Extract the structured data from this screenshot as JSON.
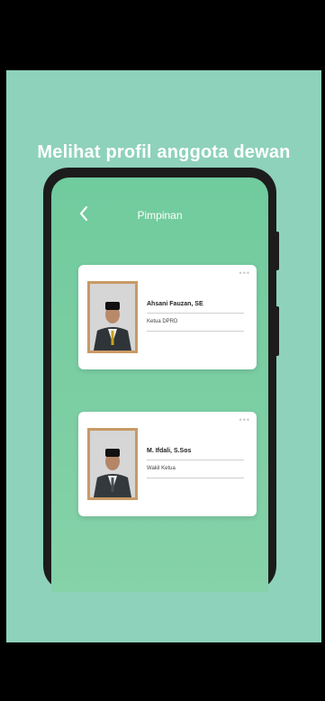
{
  "headline": "Melihat profil anggota dewan",
  "app": {
    "title": "Pimpinan",
    "members": [
      {
        "name": "Ahsani Fauzan, SE",
        "role": "Ketua DPRD"
      },
      {
        "name": "M. Ifdali, S.Sos",
        "role": "Wakil Ketua"
      }
    ]
  },
  "colors": {
    "background": "#8ed2bb",
    "screen": "#78cda2",
    "phone_frame": "#1c1c1c"
  },
  "icons": {
    "back": "chevron-left-icon",
    "more": "more-dots-icon"
  }
}
